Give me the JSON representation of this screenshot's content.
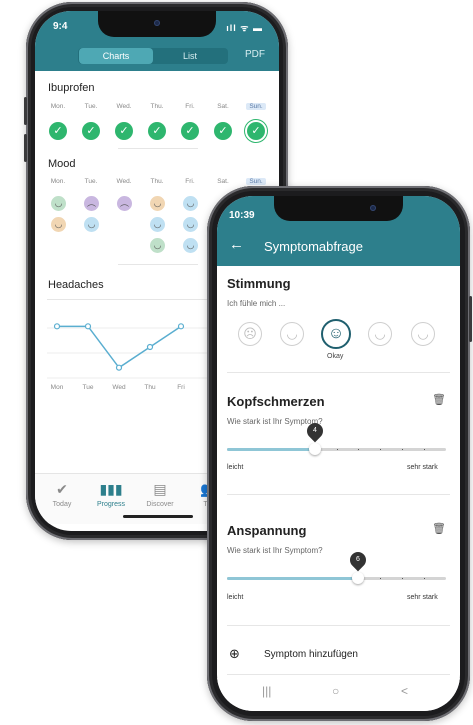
{
  "progress_screen": {
    "status_time": "9:4",
    "status_icons": "ıll ᯤ ▬",
    "tabs": [
      {
        "label": "Charts",
        "active": true
      },
      {
        "label": "List",
        "active": false
      }
    ],
    "pdf": "PDF",
    "days": [
      "Mon.",
      "Tue.",
      "Wed.",
      "Thu.",
      "Fri.",
      "Sat.",
      "Sun."
    ],
    "ibuprofen": {
      "title": "Ibuprofen",
      "checks": [
        "✓",
        "✓",
        "✓",
        "✓",
        "✓",
        "✓",
        "✓"
      ]
    },
    "mood": {
      "title": "Mood",
      "days_partial": [
        "Mon.",
        "Tue.",
        "Wed.",
        "Thu.",
        "Fri.",
        "Sat.",
        "Sun."
      ]
    },
    "headaches": {
      "title": "Headaches",
      "chart_data": {
        "type": "line",
        "categories": [
          "Mon",
          "Tue",
          "Wed",
          "Thu",
          "Fri"
        ],
        "values": [
          5,
          5,
          1,
          3,
          5
        ],
        "title": "Headaches",
        "xlabel": "",
        "ylabel": "",
        "ylim": [
          0,
          6
        ]
      }
    },
    "tabbar": [
      {
        "label": "Today",
        "icon": "✔",
        "active": false
      },
      {
        "label": "Progress",
        "icon": "▮▮▮",
        "active": true
      },
      {
        "label": "Discover",
        "icon": "▤",
        "active": false
      },
      {
        "label": "Tea",
        "icon": "👥",
        "active": false
      }
    ],
    "colors": {
      "header": "#2d7f8c",
      "check": "#2eb66e"
    }
  },
  "survey_screen": {
    "status_time": "10:39",
    "title": "Symptomabfrage",
    "stimmung": {
      "title": "Stimmung",
      "subtitle": "Ich fühle mich ...",
      "selected_label": "Okay"
    },
    "kopfschmerzen": {
      "title": "Kopfschmerzen",
      "question": "Wie stark ist Ihr Symptom?",
      "value": "4",
      "min_label": "leicht",
      "max_label": "sehr stark",
      "level": 0.4
    },
    "anspannung": {
      "title": "Anspannung",
      "question": "Wie stark ist Ihr Symptom?",
      "value": "6",
      "min_label": "leicht",
      "max_label": "sehr stark",
      "level": 0.6
    },
    "add_symptom": "Symptom hinzufügen",
    "nav": [
      "|||",
      "○",
      "<"
    ]
  }
}
